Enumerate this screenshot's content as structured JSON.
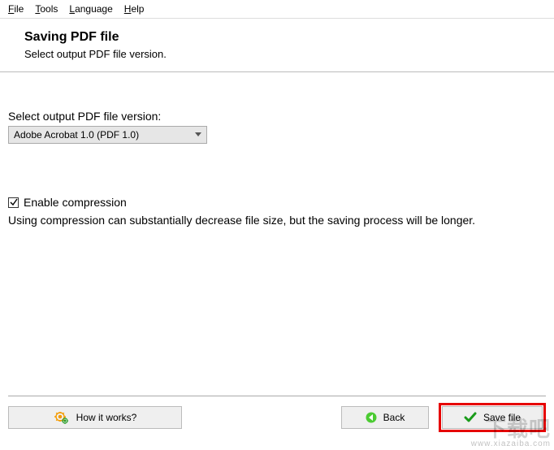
{
  "menu": {
    "file": "File",
    "tools": "Tools",
    "language": "Language",
    "help": "Help"
  },
  "header": {
    "title": "Saving PDF file",
    "subtitle": "Select output PDF file version."
  },
  "content": {
    "version_label": "Select output PDF file version:",
    "version_selected": "Adobe Acrobat 1.0 (PDF 1.0)",
    "enable_compression_label": "Enable compression",
    "enable_compression_checked": true,
    "compression_hint": "Using compression can substantially decrease file size, but the saving process will be longer."
  },
  "footer": {
    "how_it_works": "How it works?",
    "back": "Back",
    "save_file": "Save file"
  },
  "watermark": {
    "line1": "下载吧",
    "line2": "www.xiazaiba.com"
  }
}
